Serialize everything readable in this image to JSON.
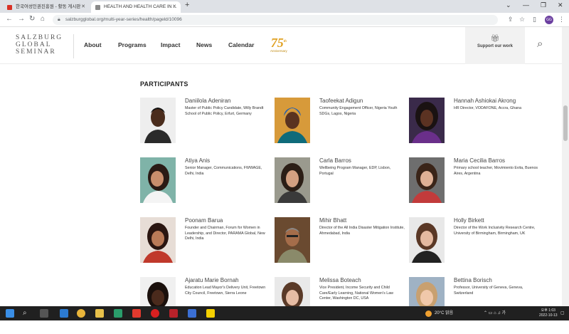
{
  "browser": {
    "tabs": [
      {
        "title": "한국여성인권진흥원 - 활동 게시판",
        "favicon_color": "#d93025"
      },
      {
        "title": "HEALTH AND HEALTH CARE IN ...",
        "favicon_color": "#7a7a7a"
      }
    ],
    "address": "salzburgglobal.org/multi-year-series/health/pageld/10096",
    "profile_initials": "GG"
  },
  "site": {
    "logo_lines": [
      "SALZBURG",
      "GLOBAL",
      "SEMINAR"
    ],
    "nav": [
      "About",
      "Programs",
      "Impact",
      "News",
      "Calendar"
    ],
    "anniversary_number": "75",
    "anniversary_sup": "th",
    "anniversary_label": "Anniversary",
    "support_label": "Support our work"
  },
  "section_title": "PARTICIPANTS",
  "participants": [
    {
      "name": "Daniilola Adeniran",
      "title": "Master of Public Policy Candidate, Willy Brandt School of Public Policy, Erfurt, Germany"
    },
    {
      "name": "Taofeekat Adigun",
      "title": "Community Engagement Officer, Nigeria Youth SDGs, Lagos, Nigeria"
    },
    {
      "name": "Hannah Ashiokai Akrong",
      "title": "HR Director, VODAFONE, Accra, Ghana"
    },
    {
      "name": "Atiya Anis",
      "title": "Senior Manager, Communications, FWWAGE, Delhi, India"
    },
    {
      "name": "Carla Barros",
      "title": "Wellbeing Program Manager, EDP, Lisbon, Portugal"
    },
    {
      "name": "Maria Cecilia Barros",
      "title": "Primary school teacher, Movimiento Evita, Buenos Aires, Argentina"
    },
    {
      "name": "Poonam Barua",
      "title": "Founder and Chairman, Forum for Women in Leadership, and Director, PARAMA Global, New Delhi, India"
    },
    {
      "name": "Mihir Bhatt",
      "title": "Director of the All India Disaster Mitigation Institute, Ahmedabad, India"
    },
    {
      "name": "Holly Birkett",
      "title": "Director of the Work Inclusivity Research Centre, University of Birmingham, Birmingham, UK"
    },
    {
      "name": "Ajaratu Marie Bornah",
      "title": "Education Lead Mayor's Delivery Unit, Freetown City Council, Freetown, Sierra Leone"
    },
    {
      "name": "Melissa Boteach",
      "title": "Vice President, Income Security and Child Care/Early Learning, National Women's Law Center, Washington DC, USA"
    },
    {
      "name": "Bettina Borisch",
      "title": "Professor, University of Geneva, Geneva, Switzerland"
    }
  ],
  "taskbar": {
    "weather": "20°C  맑음",
    "time": "오후 1:03",
    "date": "2022-10-13"
  }
}
